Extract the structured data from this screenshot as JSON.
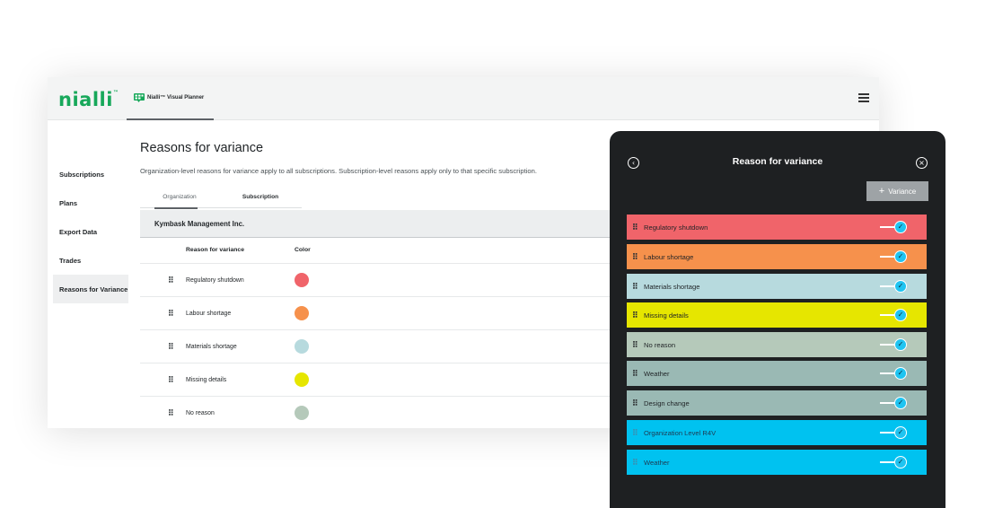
{
  "app": {
    "logo": "nialli",
    "logo_tm": "™",
    "product_tab": "Nialli™ Visual Planner",
    "menu_icon": "hamburger-menu-icon"
  },
  "sidebar": {
    "items": [
      {
        "label": "Subscriptions",
        "active": false
      },
      {
        "label": "Plans",
        "active": false
      },
      {
        "label": "Export Data",
        "active": false
      },
      {
        "label": "Trades",
        "active": false
      },
      {
        "label": "Reasons for Variance",
        "active": true
      }
    ]
  },
  "main": {
    "title": "Reasons for variance",
    "description": "Organization-level reasons for variance apply to all subscriptions. Subscription-level reasons apply only to that specific subscription.",
    "tabs": [
      {
        "label": "Organization",
        "active": true
      },
      {
        "label": "Subscription",
        "active": false
      }
    ],
    "organization": "Kymbask Management Inc.",
    "columns": {
      "reason": "Reason for variance",
      "color": "Color"
    },
    "rows": [
      {
        "name": "Regulatory shutdown",
        "color": "#f0646a"
      },
      {
        "name": "Labour shortage",
        "color": "#f6914c"
      },
      {
        "name": "Materials shortage",
        "color": "#b7dade"
      },
      {
        "name": "Missing details",
        "color": "#e6e600"
      },
      {
        "name": "No reason",
        "color": "#b5c9ba"
      }
    ]
  },
  "panel": {
    "title": "Reason for variance",
    "back_icon": "chevron-left-icon",
    "close_icon": "close-icon",
    "add_button": {
      "icon": "+",
      "label": "Variance"
    },
    "items": [
      {
        "label": "Regulatory shutdown",
        "color": "#f0646a",
        "enabled": true
      },
      {
        "label": "Labour shortage",
        "color": "#f6914c",
        "enabled": true
      },
      {
        "label": "Materials shortage",
        "color": "#b7dade",
        "enabled": true
      },
      {
        "label": "Missing details",
        "color": "#e6e600",
        "enabled": true
      },
      {
        "label": "No reason",
        "color": "#b5c9ba",
        "enabled": true
      },
      {
        "label": "Weather",
        "color": "#9ab9b4",
        "enabled": true
      },
      {
        "label": "Design change",
        "color": "#9ab9b4",
        "enabled": true
      },
      {
        "label": "Organization Level R4V",
        "color": "#00c2f0",
        "enabled": true
      },
      {
        "label": "Weather",
        "color": "#00c2f0",
        "enabled": true
      }
    ]
  }
}
